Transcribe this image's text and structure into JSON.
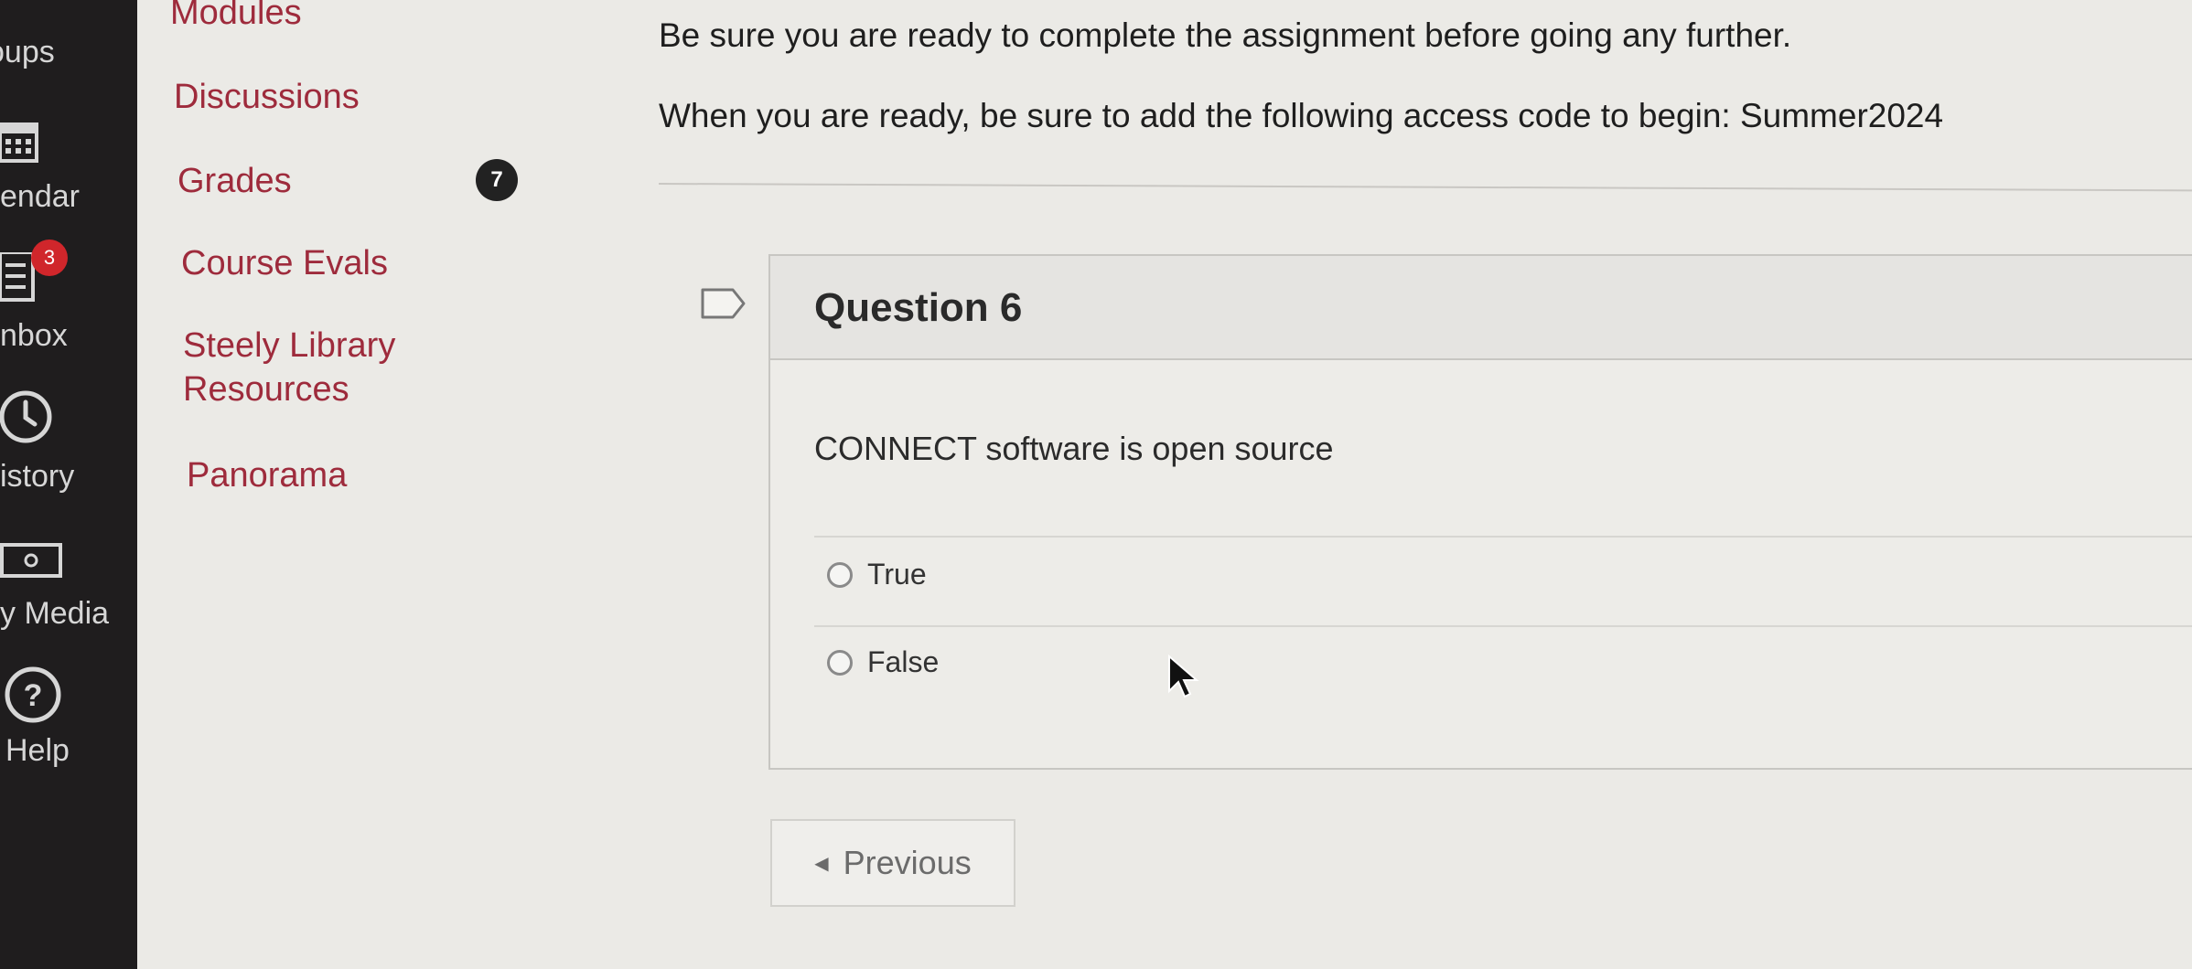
{
  "global_nav": {
    "items": [
      {
        "label": "oups",
        "icon": "groups-icon"
      },
      {
        "label": "endar",
        "icon": "calendar-icon"
      },
      {
        "label": "nbox",
        "icon": "inbox-icon",
        "badge": "3"
      },
      {
        "label": "istory",
        "icon": "history-icon"
      },
      {
        "label": "y Media",
        "icon": "media-icon"
      },
      {
        "label": "Help",
        "icon": "help-icon"
      }
    ]
  },
  "course_nav": {
    "items": [
      {
        "label": "Modules"
      },
      {
        "label": "Discussions"
      },
      {
        "label": "Grades",
        "badge": "7"
      },
      {
        "label": "Course Evals"
      },
      {
        "label": "Steely Library Resources"
      },
      {
        "label": "Panorama"
      }
    ]
  },
  "instructions": {
    "line1": "Be sure you are ready to complete the assignment before going any further.",
    "line2": "When you are ready, be sure to add the following access code to begin: Summer2024"
  },
  "question": {
    "title": "Question 6",
    "text": "CONNECT software is open source",
    "answers": [
      {
        "label": "True",
        "selected": false
      },
      {
        "label": "False",
        "selected": false
      }
    ]
  },
  "nav_buttons": {
    "previous": "Previous"
  },
  "colors": {
    "rail": "#1f1d1e",
    "link": "#9e2b3c",
    "inbox_badge": "#d0262b"
  }
}
